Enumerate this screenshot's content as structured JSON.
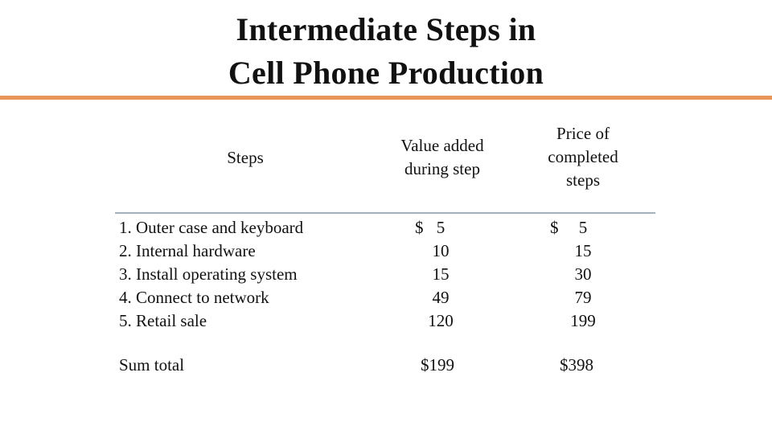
{
  "slide": {
    "title_line1": "Intermediate Steps in",
    "title_line2": "Cell Phone Production",
    "accent_color": "#e8955a",
    "divider_color": "#a3b1bd"
  },
  "table": {
    "headers": {
      "steps": "Steps",
      "value_added": [
        "Value added",
        "during step"
      ],
      "price": [
        "Price of",
        "completed",
        "steps"
      ]
    },
    "currency_symbol": "$",
    "rows": [
      {
        "step": "1. Outer case and keyboard",
        "value_added": "5",
        "price": "5"
      },
      {
        "step": "2. Internal hardware",
        "value_added": "10",
        "price": "15"
      },
      {
        "step": "3. Install operating system",
        "value_added": "15",
        "price": "30"
      },
      {
        "step": "4. Connect to network",
        "value_added": "49",
        "price": "79"
      },
      {
        "step": "5. Retail sale",
        "value_added": "120",
        "price": "199"
      }
    ],
    "total": {
      "label": "Sum total",
      "value_added": "$199",
      "price": "$398"
    }
  }
}
